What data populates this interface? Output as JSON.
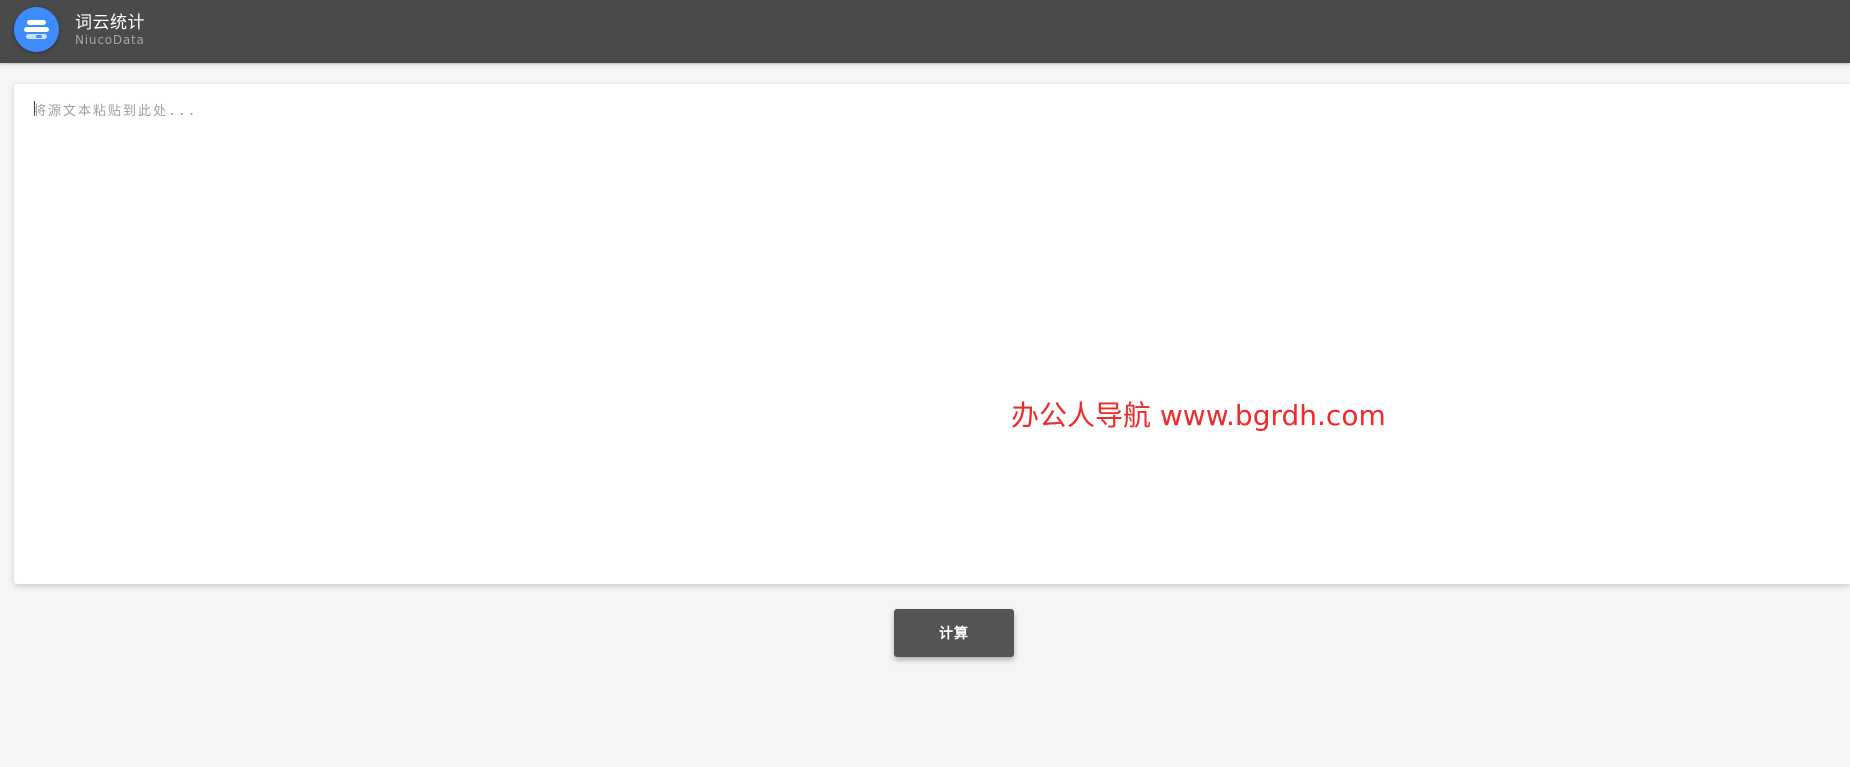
{
  "header": {
    "title": "词云统计",
    "subtitle": "NiucoData",
    "logo_icon": "stacked-lines-logo-icon",
    "background_color": "#4a4a4a",
    "logo_color": "#3d8bfd"
  },
  "editor": {
    "placeholder": "将源文本粘贴到此处...",
    "value": ""
  },
  "watermark": {
    "text": "办公人导航 www.bgrdh.com",
    "color": "#f02a2a"
  },
  "actions": {
    "calculate_label": "计算",
    "button_color": "#555555"
  },
  "page": {
    "background_color": "#f4f5f7"
  }
}
